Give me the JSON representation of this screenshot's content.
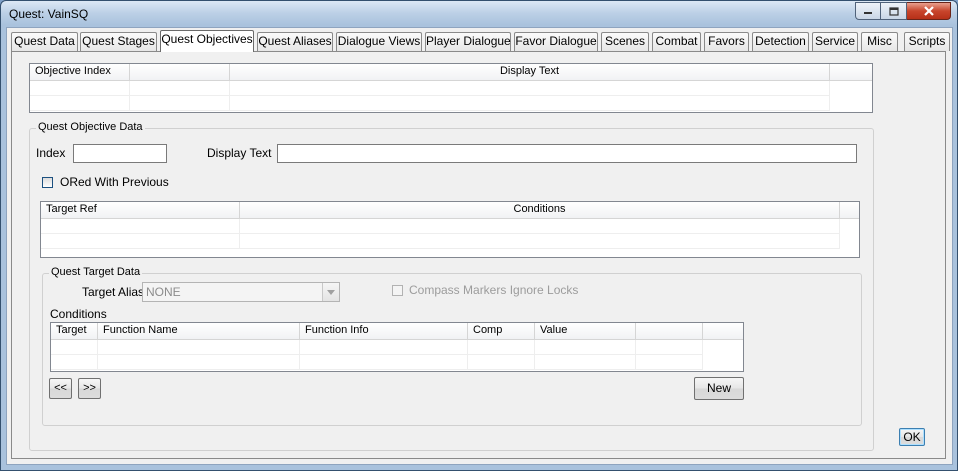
{
  "window": {
    "title": "Quest: VainSQ"
  },
  "tabs": [
    {
      "label": "Quest Data"
    },
    {
      "label": "Quest Stages"
    },
    {
      "label": "Quest Objectives"
    },
    {
      "label": "Quest Aliases"
    },
    {
      "label": "Dialogue Views"
    },
    {
      "label": "Player Dialogue"
    },
    {
      "label": "Favor Dialogue"
    },
    {
      "label": "Scenes"
    },
    {
      "label": "Combat"
    },
    {
      "label": "Favors"
    },
    {
      "label": "Detection"
    },
    {
      "label": "Service"
    },
    {
      "label": "Misc"
    },
    {
      "label": "Scripts"
    }
  ],
  "active_tab": "Quest Objectives",
  "objectives_list": {
    "columns": [
      "Objective Index",
      "",
      "Display Text",
      ""
    ]
  },
  "objective_data": {
    "legend": "Quest Objective Data",
    "index_label": "Index",
    "index_value": "",
    "display_text_label": "Display Text",
    "display_text_value": "",
    "ored_label": "ORed With Previous",
    "ored_checked": false
  },
  "targets_list": {
    "columns": [
      "Target Ref",
      "Conditions",
      ""
    ]
  },
  "target_data": {
    "legend": "Quest Target Data",
    "alias_label": "Target Alias",
    "alias_value": "NONE",
    "compass_label": "Compass Markers Ignore Locks",
    "compass_checked": false,
    "conditions_label": "Conditions",
    "conditions_columns": [
      "Target",
      "Function Name",
      "Function Info",
      "Comp",
      "Value",
      "",
      ""
    ],
    "prev_button": "<<",
    "next_button": ">>",
    "new_button": "New"
  },
  "ok_button": "OK",
  "colors": {
    "title_gradient": "#a9c2dd",
    "close_button": "#c8452c",
    "client_bg": "#f0f0f0"
  }
}
